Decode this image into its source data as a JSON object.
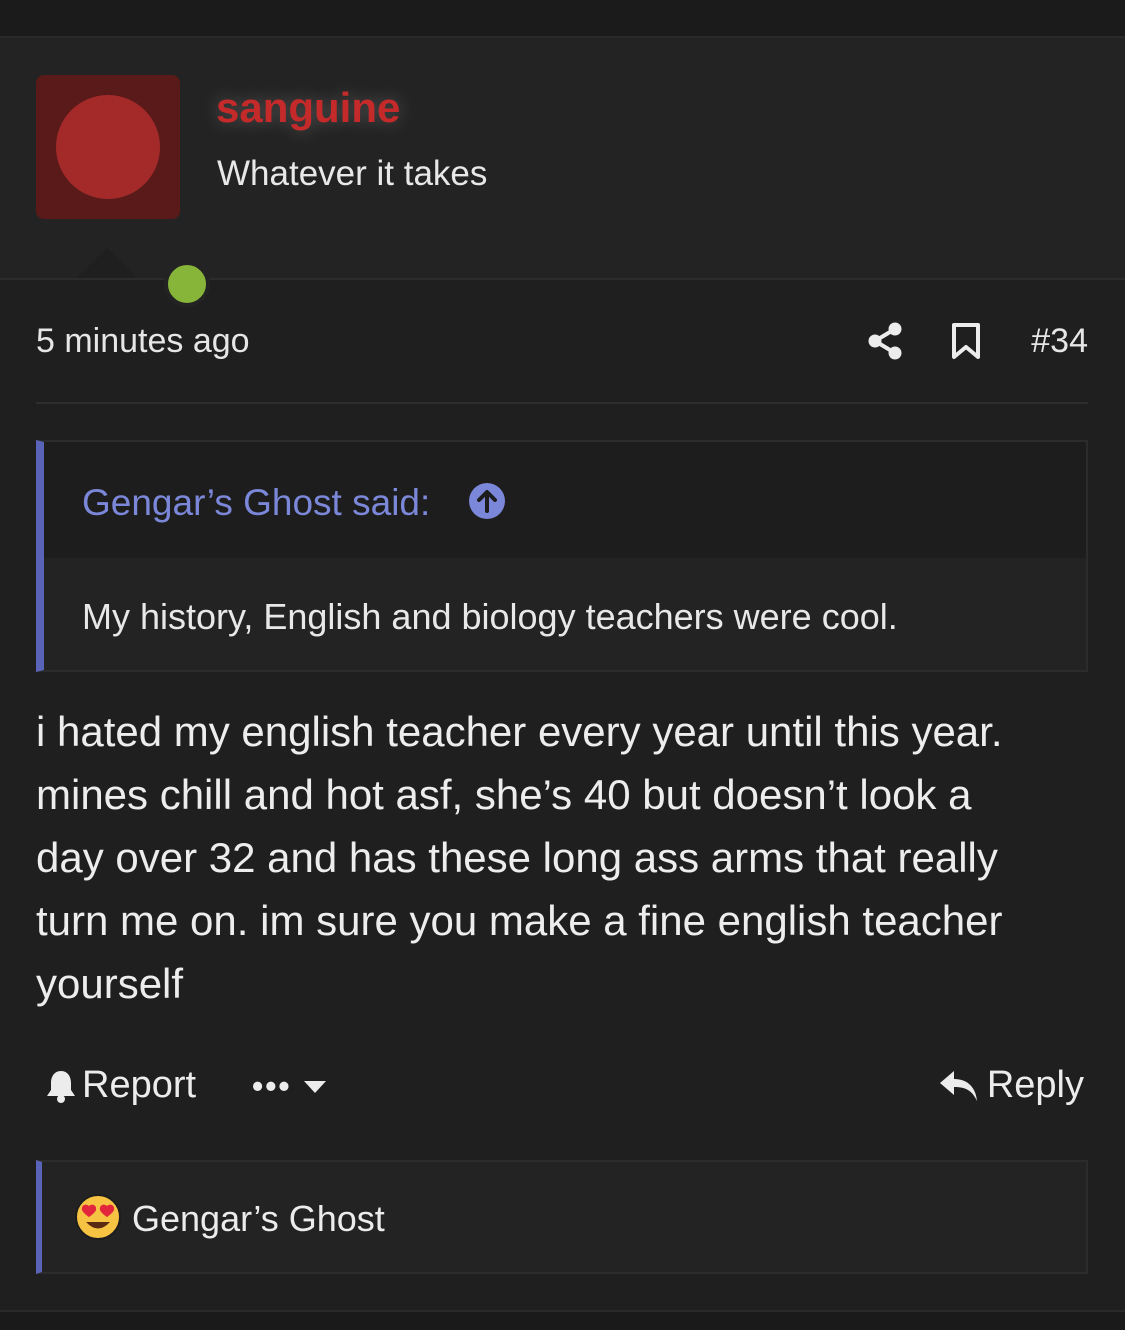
{
  "user": {
    "avatar_icon": "avatar-placeholder",
    "online_color": "#86b53a",
    "name": "sanguine",
    "name_color": "#c52a2a",
    "title": "Whatever it takes"
  },
  "post": {
    "timestamp": "5 minutes ago",
    "share_icon": "share-icon",
    "bookmark_icon": "bookmark-icon",
    "number": "#34",
    "quote": {
      "author_label": "Gengar’s Ghost said:",
      "jump_icon": "arrow-up-circle-icon",
      "text": "My history, English and biology teachers were cool."
    },
    "body_lines": [
      "i hated my english teacher every year until this year.",
      "mines chill and hot asf, she’s 40 but doesn’t look a",
      "day over 32 and has these long ass arms that really",
      "turn me on. im sure you make a fine english teacher",
      "yourself"
    ]
  },
  "actions": {
    "report_label": "Report",
    "more_label": "•••",
    "reply_label": "Reply"
  },
  "reactions": {
    "icon": "heart-eyes-emoji-icon",
    "user": "Gengar’s Ghost"
  },
  "colors": {
    "accent": "#5964b8",
    "link": "#7b87d8",
    "background": "#1f1f1f"
  }
}
